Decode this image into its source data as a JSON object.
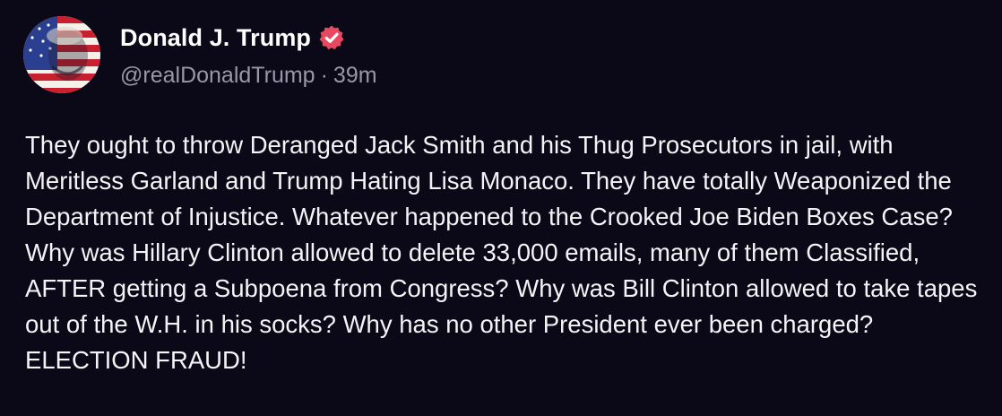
{
  "author": {
    "display_name": "Donald J. Trump",
    "handle": "@realDonaldTrump",
    "separator": "·",
    "time_ago": "39m",
    "verified_icon": "verified-badge-icon",
    "avatar_icon": "profile-avatar"
  },
  "post": {
    "text": "They ought to throw Deranged Jack Smith and his Thug Prosecutors in jail, with Meritless Garland and Trump Hating Lisa Monaco. They have totally Weaponized the Department of Injustice. Whatever happened to the Crooked Joe Biden Boxes Case? Why was Hillary Clinton allowed to delete 33,000 emails, many of them Classified, AFTER getting a Subpoena from Congress? Why was Bill Clinton allowed to take tapes out of the W.H. in his socks? Why has no other President ever been charged? ELECTION FRAUD!"
  },
  "colors": {
    "background": "#0b0818",
    "text": "#f4f4f6",
    "muted": "#9a97a8",
    "verified": "#e8495f"
  }
}
